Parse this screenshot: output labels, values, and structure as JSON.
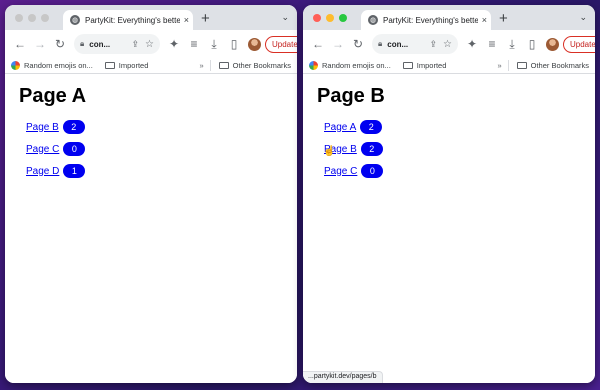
{
  "colors": {
    "tab_strip": "#dee1e6",
    "link": "#0000ee",
    "badge": "#0000f0",
    "update_red": "#d93025",
    "traffic_red": "#ff5f57",
    "traffic_yellow": "#febc2e",
    "traffic_green": "#28c840",
    "traffic_inactive": "#c7c7c7"
  },
  "windows": [
    {
      "active": false,
      "tab": {
        "title": "PartyKit: Everything's better w",
        "close": "×",
        "favicon": "globe-icon"
      },
      "new_tab": "+",
      "tab_menu": "⌄",
      "toolbar": {
        "back": "←",
        "forward": "→",
        "reload": "↻",
        "url": "con...",
        "update_label": "Update",
        "menu": "⋮"
      },
      "bookmarks": {
        "items": [
          "Random emojis on...",
          "Imported"
        ],
        "overflow": "»",
        "other": "Other Bookmarks"
      },
      "page": {
        "heading": "Page A",
        "links": [
          {
            "label": "Page B",
            "count": "2"
          },
          {
            "label": "Page C",
            "count": "0"
          },
          {
            "label": "Page D",
            "count": "1"
          }
        ]
      }
    },
    {
      "active": true,
      "tab": {
        "title": "PartyKit: Everything's better w",
        "close": "×",
        "favicon": "globe-icon"
      },
      "new_tab": "+",
      "tab_menu": "⌄",
      "toolbar": {
        "back": "←",
        "forward": "→",
        "reload": "↻",
        "url": "con...",
        "update_label": "Update",
        "menu": "⋮"
      },
      "bookmarks": {
        "items": [
          "Random emojis on...",
          "Imported"
        ],
        "overflow": "»",
        "other": "Other Bookmarks"
      },
      "page": {
        "heading": "Page B",
        "links": [
          {
            "label": "Page A",
            "count": "2"
          },
          {
            "label": "Page B",
            "count": "2"
          },
          {
            "label": "Page C",
            "count": "0"
          }
        ]
      },
      "status_bar": "...partykit.dev/pages/b"
    }
  ]
}
